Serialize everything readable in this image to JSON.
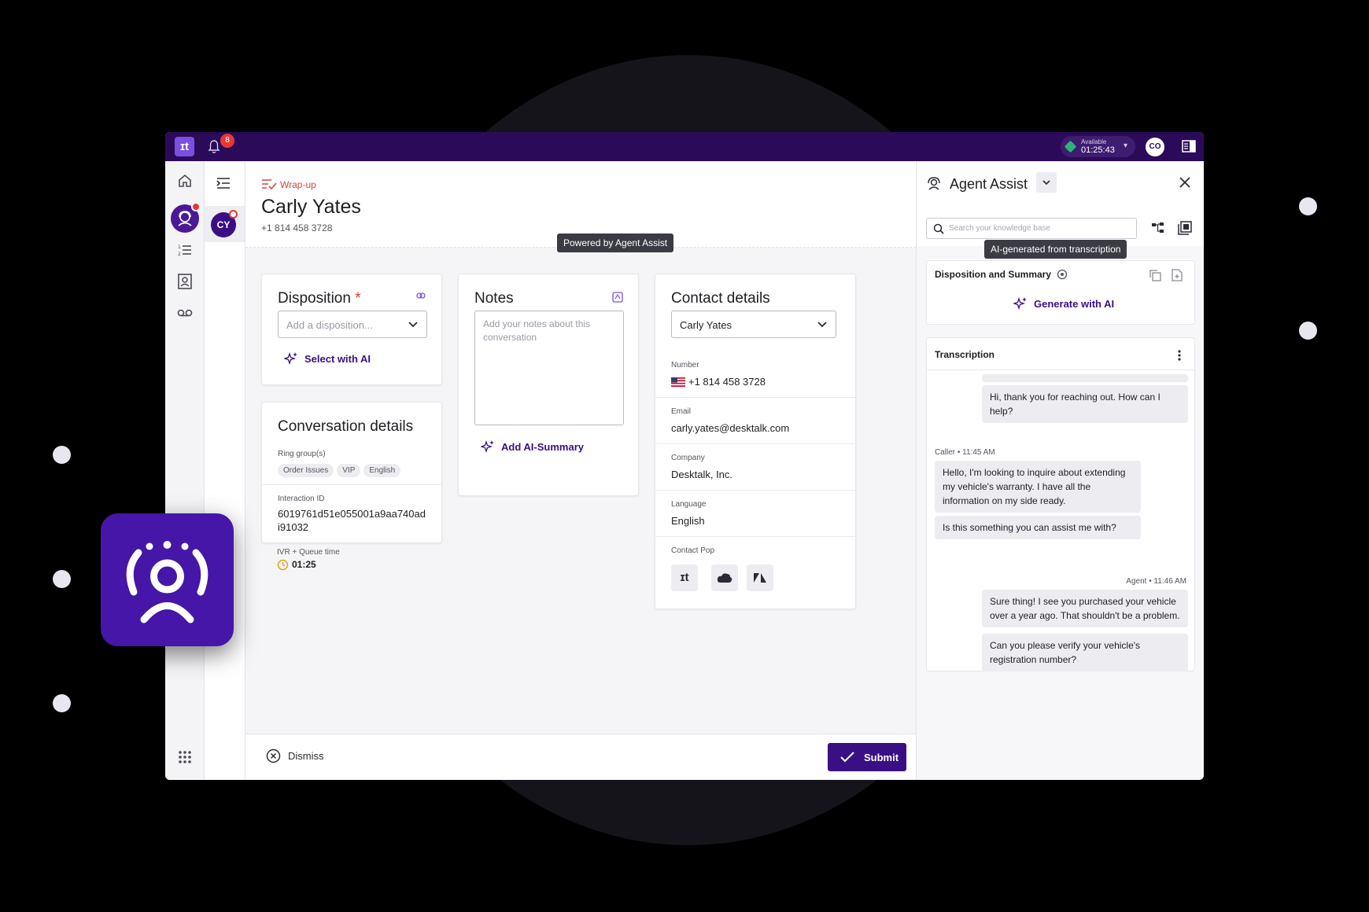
{
  "colors": {
    "brand": "#2b0a5a",
    "accent": "#3a0f85",
    "required": "#e53935",
    "available": "#2bb673"
  },
  "topbar": {
    "logo_text": "ɪt",
    "notification_count": "8",
    "status_label": "Available",
    "status_time": "01:25:43",
    "user_initials": "CO"
  },
  "conversation_list": {
    "active_initials": "CY"
  },
  "header": {
    "tag": "Wrap-up",
    "contact_name": "Carly Yates",
    "contact_phone": "+1 814 458 3728"
  },
  "disposition": {
    "title": "Disposition",
    "required_mark": "*",
    "placeholder": "Add a disposition...",
    "ai_action": "Select with AI"
  },
  "conversation_details": {
    "title": "Conversation details",
    "ring_groups_label": "Ring group(s)",
    "ring_groups": [
      "Order Issues",
      "VIP",
      "English"
    ],
    "interaction_id_label": "Interaction ID",
    "interaction_id_line1": "6019761d51e055001a9aa740ad",
    "interaction_id_line2": "i91032",
    "queue_time_label": "IVR + Queue time",
    "queue_time": "01:25"
  },
  "notes": {
    "title": "Notes",
    "placeholder": "Add your notes about this conversation",
    "ai_action": "Add AI-Summary",
    "tooltip": "Powered by Agent Assist"
  },
  "contact_details": {
    "title": "Contact details",
    "selected_contact": "Carly Yates",
    "number_label": "Number",
    "number": "+1 814 458 3728",
    "email_label": "Email",
    "email": "carly.yates@desktalk.com",
    "company_label": "Company",
    "company": "Desktalk, Inc.",
    "language_label": "Language",
    "language": "English",
    "contact_pop_label": "Contact Pop",
    "contact_pop_icons": [
      "talkdesk-icon",
      "salesforce-icon",
      "zendesk-icon"
    ]
  },
  "footer": {
    "dismiss_label": "Dismiss",
    "submit_label": "Submit"
  },
  "agent_assist": {
    "title": "Agent Assist",
    "search_placeholder": "Search your knowledge base",
    "tooltip": "AI-generated from transcription",
    "summary_title": "Disposition and Summary",
    "generate_action": "Generate with AI",
    "transcription_title": "Transcription",
    "messages": [
      {
        "text": "Hi, thank you for reaching out. How can I help?"
      },
      {
        "meta": "Caller • 11:45 AM"
      },
      {
        "text": "Hello, I'm looking to inquire about extending my vehicle's warranty. I have all the information on my side ready."
      },
      {
        "text": "Is this something you can assist me with?"
      },
      {
        "meta": "Agent • 11:46 AM"
      },
      {
        "text": "Sure thing! I see you purchased your vehicle over a year ago. That shouldn't be a problem."
      },
      {
        "text": "Can you please verify your vehicle's registration number?"
      }
    ]
  }
}
